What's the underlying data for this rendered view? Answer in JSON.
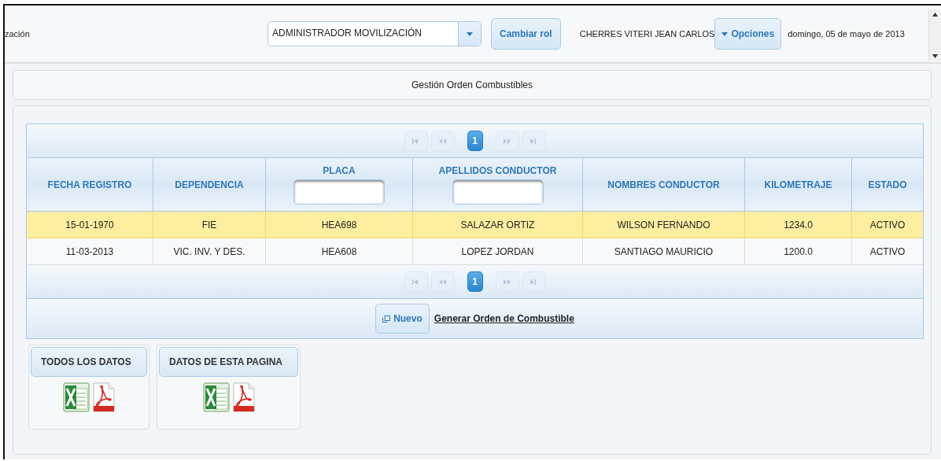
{
  "header": {
    "app_title": "zación",
    "role_select": {
      "value": "ADMINISTRADOR MOVILIZACIÓN"
    },
    "change_role_button": "Cambiar rol",
    "user_name": "CHERRES VITERI JEAN CARLOS",
    "options_button": "Opciones",
    "date": "domingo, 05 de mayo de 2013"
  },
  "page_title": "Gestión Orden Combustibles",
  "table": {
    "paginators": [
      {
        "nav_disabled": true,
        "pages": [
          {
            "label": "1",
            "selected": true
          }
        ]
      },
      {
        "nav_disabled": true,
        "pages": [
          {
            "label": "1",
            "selected": true
          }
        ]
      }
    ],
    "columns": [
      {
        "label": "FECHA REGISTRO",
        "filter": false
      },
      {
        "label": "DEPENDENCIA",
        "filter": false
      },
      {
        "label": "PLACA",
        "filter": true
      },
      {
        "label": "APELLIDOS CONDUCTOR",
        "filter": true
      },
      {
        "label": "NOMBRES CONDUCTOR",
        "filter": false
      },
      {
        "label": "KILOMETRAJE",
        "filter": false
      },
      {
        "label": "ESTADO",
        "filter": false
      }
    ],
    "rows": [
      {
        "selected": true,
        "cells": [
          "15-01-1970",
          "FIE",
          "HEA698",
          "SALAZAR ORTIZ",
          "WILSON FERNANDO",
          "1234.0",
          "ACTIVO"
        ]
      },
      {
        "selected": false,
        "cells": [
          "11-03-2013",
          "VIC. INV. Y DES.",
          "HEA608",
          "LOPEZ JORDAN",
          "SANTIAGO MAURICIO",
          "1200.0",
          "ACTIVO"
        ]
      }
    ]
  },
  "footer": {
    "new_button": "Nuevo",
    "link": "Generar Orden de Combustible"
  },
  "exports": [
    {
      "title": "TODOS LOS DATOS"
    },
    {
      "title": "DATOS DE ESTA PAGINA"
    }
  ]
}
